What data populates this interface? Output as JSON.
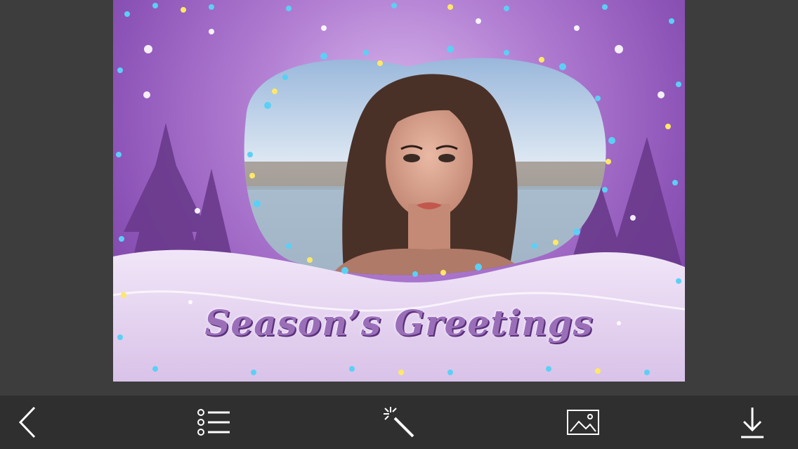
{
  "card": {
    "greeting_text": "Season’s Greetings"
  },
  "toolbar": {
    "buttons": [
      {
        "icon": "back-arrow-icon"
      },
      {
        "icon": "list-menu-icon"
      },
      {
        "icon": "magic-wand-icon"
      },
      {
        "icon": "image-gallery-icon"
      },
      {
        "icon": "download-icon"
      }
    ]
  },
  "colors": {
    "toolbar_bg": "#2f2f2f",
    "canvas_bg": "#3d3d3d",
    "frame_purple": "#8e55b8",
    "greeting_text": "#9a6fb8",
    "icon_white": "#ffffff"
  }
}
